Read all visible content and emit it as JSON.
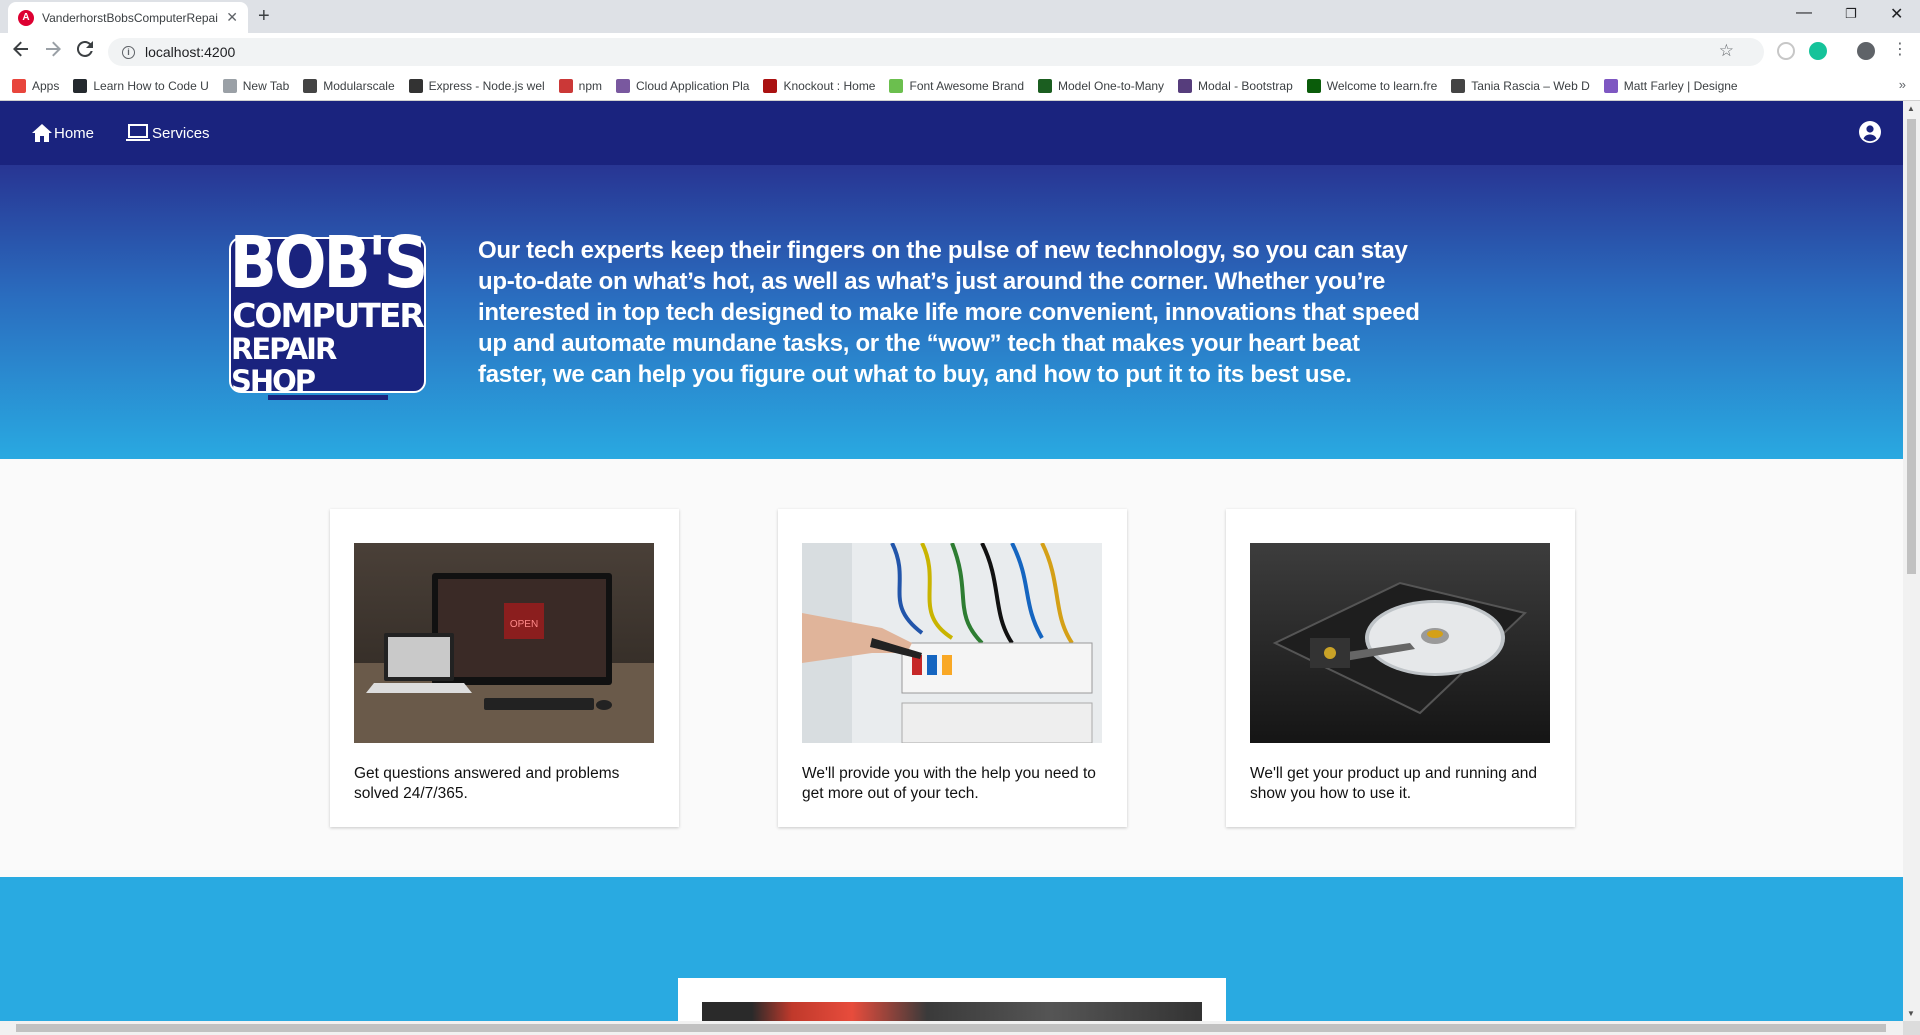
{
  "browser": {
    "tab_title": "VanderhorstBobsComputerRepai",
    "tab_favicon_letter": "A",
    "tab_close": "✕",
    "new_tab": "+",
    "url": "localhost:4200",
    "window_minimize": "—",
    "window_restore": "❐",
    "window_close": "✕",
    "bookmarks": [
      {
        "label": "Apps",
        "icon": "apps-grid-icon",
        "color": "#e8453c"
      },
      {
        "label": "Learn How to Code U",
        "icon": "github-icon",
        "color": "#24292e"
      },
      {
        "label": "New Tab",
        "icon": "page-icon",
        "color": "#9aa0a6"
      },
      {
        "label": "Modularscale",
        "icon": "modularscale-icon",
        "color": "#444"
      },
      {
        "label": "Express - Node.js wel",
        "icon": "express-icon",
        "color": "#333"
      },
      {
        "label": "npm",
        "icon": "npm-icon",
        "color": "#cb3837"
      },
      {
        "label": "Cloud Application Pla",
        "icon": "heroku-icon",
        "color": "#79589f"
      },
      {
        "label": "Knockout : Home",
        "icon": "knockout-icon",
        "color": "#a11"
      },
      {
        "label": "Font Awesome Brand",
        "icon": "fontawesome-icon",
        "color": "#6bbf4e"
      },
      {
        "label": "Model One-to-Many",
        "icon": "mongoose-icon",
        "color": "#1b5e20"
      },
      {
        "label": "Modal - Bootstrap",
        "icon": "bootstrap-icon",
        "color": "#563d7c"
      },
      {
        "label": "Welcome to learn.fre",
        "icon": "freecodecamp-icon",
        "color": "#0a5c0a"
      },
      {
        "label": "Tania Rascia – Web D",
        "icon": "floppy-icon",
        "color": "#444"
      },
      {
        "label": "Matt Farley | Designe",
        "icon": "mattfarley-icon",
        "color": "#7e57c2"
      }
    ]
  },
  "nav": {
    "home_label": "Home",
    "services_label": "Services"
  },
  "hero": {
    "logo_line1": "BOB'S",
    "logo_line2": "COMPUTER",
    "logo_line3": "REPAIR SHOP",
    "text": "Our tech experts keep their fingers on the pulse of new technology, so you can stay up-to-date on what’s hot, as well as what’s just around the corner. Whether you’re interested in top tech designed to make life more convenient, innovations that speed up and automate mundane tasks, or the “wow” tech that makes your heart beat faster, we can help you figure out what to buy, and how to put it to its best use."
  },
  "cards": [
    {
      "text": "Get questions answered and problems solved 24/7/365."
    },
    {
      "text": "We'll provide you with the help you need to get more out of your tech."
    },
    {
      "text": "We'll get your product up and running and show you how to use it."
    }
  ],
  "card_images": {
    "card1_screen_sign": "OPEN"
  }
}
